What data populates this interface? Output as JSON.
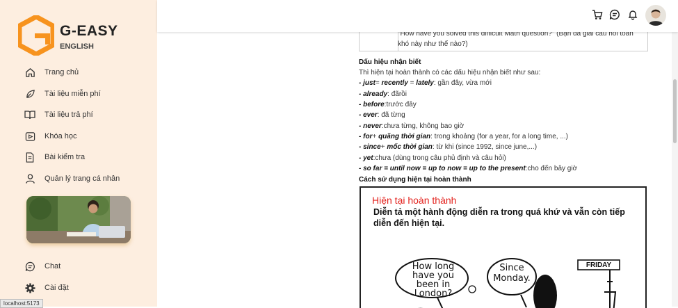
{
  "brand": {
    "name": "G-EASY",
    "sub": "ENGLISH",
    "color": "#f7931e"
  },
  "nav": [
    {
      "label": "Trang chủ",
      "icon": "home-icon"
    },
    {
      "label": "Tài liệu miễn phí",
      "icon": "leaf-icon"
    },
    {
      "label": "Tài liệu trả phí",
      "icon": "book-open-icon"
    },
    {
      "label": "Khóa học",
      "icon": "video-icon"
    },
    {
      "label": "Bài kiểm tra",
      "icon": "document-icon"
    },
    {
      "label": "Quản lý trang cá nhân",
      "icon": "user-icon"
    }
  ],
  "nav_bottom": [
    {
      "label": "Chat",
      "icon": "chat-icon"
    },
    {
      "label": "Cài đặt",
      "icon": "gear-icon"
    }
  ],
  "status_url": "localhost:5173",
  "topbar": {
    "icons": [
      "cart-icon",
      "message-icon",
      "bell-icon",
      "avatar"
    ]
  },
  "content": {
    "question": "\"How have you solved this difficult Math question?\" (Bạn đã giải câu hỏi toán khó này như thế nào?)",
    "signs_heading": "Dấu hiệu nhận biết",
    "signs_intro": "Thì hiện tại hoàn thành có các dấu hiệu nhận biết như sau:",
    "signs": [
      {
        "term": "- just",
        "rest": "=  ",
        "term2": "recently",
        "rest2": " =  ",
        "term3": "lately",
        "rest3": ": gần đây, vừa mới"
      },
      {
        "term": "- already",
        "rest": ": đãrồi"
      },
      {
        "term": "- before",
        "rest": ":trước đây"
      },
      {
        "term": "- ever",
        "rest": ": đã từng"
      },
      {
        "term": "- never",
        "rest": ":chưa từng, không bao giờ"
      },
      {
        "term": "- for",
        "rest": "+ ",
        "term2": "quãng thời gian",
        "rest2": ": trong khoảng (for a year, for a long time, ...)"
      },
      {
        "term": "- since",
        "rest": "+ ",
        "term2": "mốc thời gian",
        "rest2": ": từ khi (since 1992, since june,...)"
      },
      {
        "term": "- yet",
        "rest": ":chưa (dùng trong câu phủ định và câu hỏi)"
      },
      {
        "term": "- so far = until now = up to now = up to the present",
        "rest": ":cho đến bây giờ"
      }
    ],
    "usage_heading": "Cách sử dụng hiện tại hoàn thành",
    "image": {
      "title": "Hiện tại hoàn thành",
      "desc": "Diễn tả một hành  động diễn ra trong quá khứ và vẫn còn tiếp diễn đến hiện tại.",
      "bubble1": "How long have you been in London?",
      "bubble2": "Since Monday.",
      "sign": "FRIDAY"
    }
  }
}
